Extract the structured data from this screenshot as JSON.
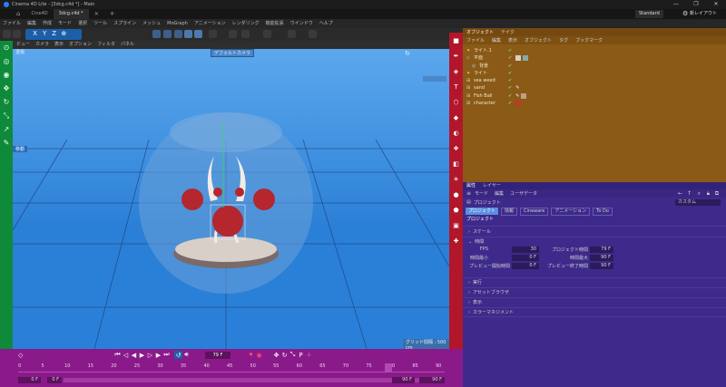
{
  "window": {
    "title": "Cinema 4D Lite - [3dcg.c4d *] - Main",
    "controls": [
      "—",
      "❐",
      "✕"
    ]
  },
  "tabs": [
    {
      "label": "Cine4D"
    },
    {
      "label": "3dcg.c4d *"
    }
  ],
  "layout": {
    "selected": "Standard",
    "new_layout": "新レイアウト"
  },
  "menu": [
    "ファイル",
    "編集",
    "作成",
    "モード",
    "選択",
    "ツール",
    "スプライン",
    "メッシュ",
    "MoGraph",
    "アニメーション",
    "レンダリング",
    "機能拡張",
    "ウインドウ",
    "ヘルプ"
  ],
  "viewport": {
    "menu": [
      "ビュー",
      "カメラ",
      "表示",
      "オプション",
      "フィルタ",
      "パネル"
    ],
    "camera_label": "透視",
    "camera_dropdown": "デフォルトカメラ",
    "grid_info": "グリッド間隔 : 500 cm",
    "side_label": "移動"
  },
  "objects": {
    "tabs": [
      "オブジェクト",
      "テイク"
    ],
    "menu": [
      "ファイル",
      "編集",
      "表示",
      "オブジェクト",
      "タグ",
      "ブックマーク"
    ],
    "items": [
      {
        "name": "ライト.1",
        "icon": "light-icon"
      },
      {
        "name": "平面",
        "icon": "plane-icon"
      },
      {
        "name": "背景",
        "icon": "background-icon"
      },
      {
        "name": "ライト",
        "icon": "light-icon"
      },
      {
        "name": "sea weed",
        "icon": "null-icon"
      },
      {
        "name": "sand",
        "icon": "null-icon"
      },
      {
        "name": "Fish Ball",
        "icon": "null-icon"
      },
      {
        "name": "character",
        "icon": "null-icon"
      }
    ]
  },
  "attributes": {
    "tabs": [
      "属性",
      "レイヤー"
    ],
    "menu": [
      "モード",
      "編集",
      "ユーザデータ"
    ],
    "scope": "プロジェクト",
    "custom_dropdown": "カスタム",
    "subtabs": [
      "プロジェクト",
      "情報",
      "Cineware",
      "アニメーション",
      "To Do"
    ],
    "section": "プロジェクト",
    "groups": {
      "scale": "スケール",
      "time": "時間",
      "execute": "実行",
      "asset": "アセットブラウザ",
      "display": "表示",
      "color": "カラーマネジメント"
    },
    "fields": [
      {
        "label": "FPS",
        "value": "30"
      },
      {
        "label": "プロジェクト時間",
        "value": "79 F"
      },
      {
        "label": "時間最小",
        "value": "0 F"
      },
      {
        "label": "時間最大",
        "value": "90 F"
      },
      {
        "label": "プレビュー開始時間",
        "value": "0 F"
      },
      {
        "label": "プレビュー終了時間",
        "value": "90 F"
      }
    ]
  },
  "timeline": {
    "current_frame": "79 F",
    "start_field": "0 F",
    "start_field2": "0 F",
    "end_field": "90 F",
    "end_field2": "90 F",
    "ticks": [
      "0",
      "5",
      "10",
      "15",
      "20",
      "25",
      "30",
      "35",
      "40",
      "45",
      "50",
      "55",
      "60",
      "65",
      "70",
      "75",
      "80",
      "85",
      "90"
    ],
    "playhead": 79,
    "frame_max": 90
  },
  "colors": {
    "left_tools": "#0e8a3a",
    "right_tools": "#b2162b",
    "object_panel": "#8a5a16",
    "attr_panel": "#3e2a8a",
    "timeline": "#8a1a8a",
    "viewport_sky": "#3b8fe0"
  }
}
